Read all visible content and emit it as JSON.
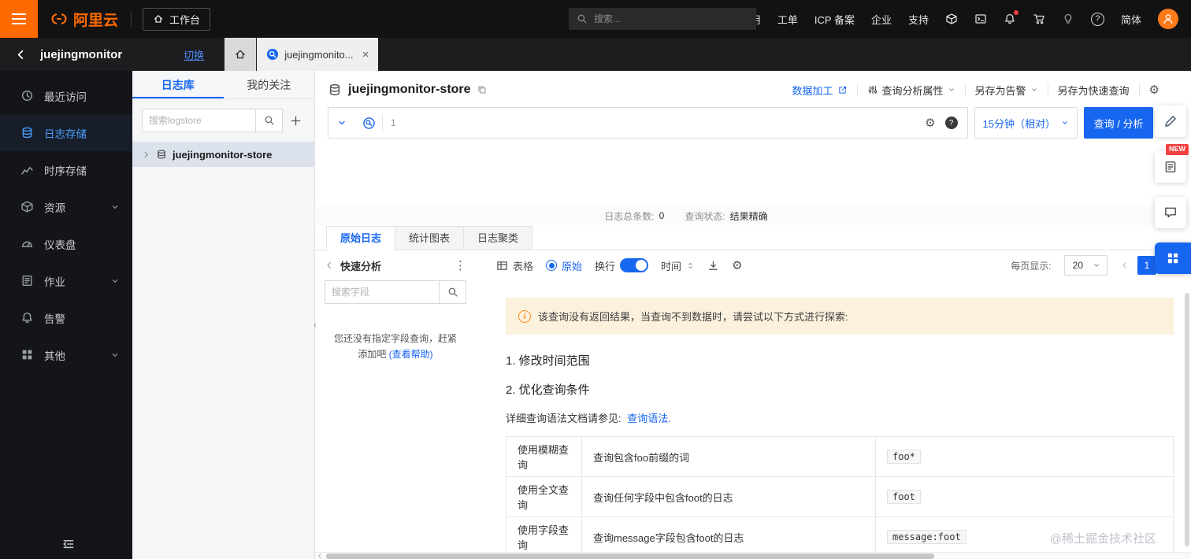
{
  "colors": {
    "brand_orange": "#ff6a00",
    "accent_blue": "#1766f0",
    "badge_red": "#f53f3f",
    "banner_bg": "#fcf1dd",
    "sidebar_bg": "#141519"
  },
  "icons": {
    "gear": "⚙",
    "question": "?",
    "info": "i",
    "close": "×",
    "ellipsis_v": "⋮",
    "panel_collapse": "‹",
    "plus": "＋"
  },
  "topbar": {
    "logo": "阿里云",
    "workbench": "工作台",
    "search_placeholder": "搜索...",
    "nav": [
      "费用",
      "工单",
      "ICP 备案",
      "企业",
      "支持"
    ],
    "language": "简体"
  },
  "console_bar": {
    "project": "juejingmonitor",
    "switch": "切换",
    "tab": "juejingmonito..."
  },
  "sidebar": {
    "items": [
      {
        "label": "最近访问"
      },
      {
        "label": "日志存储"
      },
      {
        "label": "时序存储"
      },
      {
        "label": "资源"
      },
      {
        "label": "仪表盘"
      },
      {
        "label": "作业"
      },
      {
        "label": "告警"
      },
      {
        "label": "其他"
      }
    ]
  },
  "logstore_panel": {
    "tab_logstore": "日志库",
    "tab_favorites": "我的关注",
    "search_placeholder": "搜索logstore",
    "item": "juejingmonitor-store"
  },
  "store": {
    "title": "juejingmonitor-store",
    "actions": {
      "data_process": "数据加工",
      "query_props": "查询分析属性",
      "save_alert": "另存为告警",
      "save_quick": "另存为快速查询"
    },
    "query": {
      "line_no": "1",
      "time_range": "15分钟（相对）",
      "run": "查询 / 分析"
    },
    "stats": {
      "count_label": "日志总条数:",
      "count": "0",
      "status_label": "查询状态:",
      "status": "结果精确"
    },
    "tabs": [
      "原始日志",
      "统计图表",
      "日志聚类"
    ],
    "toolbar": {
      "quick_analysis": "快速分析",
      "view_table": "表格",
      "view_raw": "原始",
      "wrap": "换行",
      "time": "时间",
      "page_size_label": "每页显示:",
      "page_size": "20",
      "page": "1"
    },
    "fields": {
      "search_placeholder": "搜索字段",
      "empty_line1": "您还没有指定字段查询，赶紧",
      "empty_line2": "添加吧",
      "help_link": "(查看帮助)"
    },
    "empty": {
      "banner": "该查询没有返回结果，当查询不到数据时，请尝试以下方式进行探索:",
      "tip1": "1. 修改时间范围",
      "tip2": "2. 优化查询条件",
      "doc_prefix": "详细查询语法文档请参见:",
      "doc_link": "查询语法.",
      "examples": [
        {
          "method": "使用模糊查询",
          "desc": "查询包含foo前缀的词",
          "code": "foo*"
        },
        {
          "method": "使用全文查询",
          "desc": "查询任何字段中包含foot的日志",
          "code": "foot"
        },
        {
          "method": "使用字段查询",
          "desc": "查询message字段包含foot的日志",
          "code": "message:foot"
        }
      ]
    }
  },
  "floating": {
    "new_badge": "NEW"
  },
  "watermark": "@稀土掘金技术社区"
}
